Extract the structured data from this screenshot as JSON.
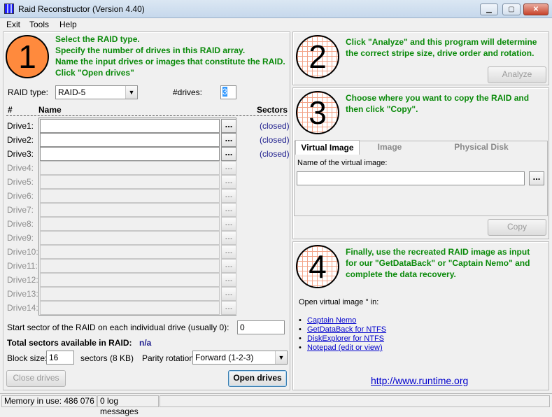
{
  "window": {
    "title": "Raid Reconstructor (Version 4.40)",
    "minimize": "▁",
    "maximize": "▢",
    "close": "✕"
  },
  "menu": [
    "Exit",
    "Tools",
    "Help"
  ],
  "step1": {
    "number": "1",
    "instructions": [
      "Select the RAID type.",
      "Specify the number of drives in this RAID array.",
      "Name the input drives or images that constitute the RAID.",
      "Click \"Open drives\""
    ],
    "raid_type_label": "RAID type:",
    "raid_type_value": "RAID-5",
    "drives_label": "#drives:",
    "drives_value": "3",
    "col_num": "#",
    "col_name": "Name",
    "col_sectors": "Sectors",
    "drives": [
      {
        "label": "Drive1:",
        "status": "(closed)"
      },
      {
        "label": "Drive2:",
        "status": "(closed)"
      },
      {
        "label": "Drive3:",
        "status": "(closed)"
      },
      {
        "label": "Drive4:",
        "status": ""
      },
      {
        "label": "Drive5:",
        "status": ""
      },
      {
        "label": "Drive6:",
        "status": ""
      },
      {
        "label": "Drive7:",
        "status": ""
      },
      {
        "label": "Drive8:",
        "status": ""
      },
      {
        "label": "Drive9:",
        "status": ""
      },
      {
        "label": "Drive10:",
        "status": ""
      },
      {
        "label": "Drive11:",
        "status": ""
      },
      {
        "label": "Drive12:",
        "status": ""
      },
      {
        "label": "Drive13:",
        "status": ""
      },
      {
        "label": "Drive14:",
        "status": ""
      }
    ],
    "browse_label": "...",
    "start_sector_label": "Start sector of the RAID on each individual drive (usually 0):",
    "start_sector_value": "0",
    "total_sectors_label": "Total sectors available in RAID:",
    "total_sectors_value": "n/a",
    "block_size_label": "Block size:",
    "block_size_value": "16",
    "block_size_unit": "sectors (8 KB)",
    "parity_label": "Parity rotation:",
    "parity_value": "Forward (1-2-3)",
    "close_drives": "Close drives",
    "open_drives": "Open drives"
  },
  "step2": {
    "number": "2",
    "instructions": [
      "Click \"Analyze\" and this program will determine",
      "the correct stripe size, drive order and rotation."
    ],
    "analyze": "Analyze"
  },
  "step3": {
    "number": "3",
    "instructions": [
      "Choose where you want to copy the RAID and",
      "then click \"Copy\"."
    ],
    "tabs": [
      "Virtual Image",
      "Image",
      "Physical Disk"
    ],
    "name_label": "Name of the virtual image:",
    "browse_label": "...",
    "copy": "Copy"
  },
  "step4": {
    "number": "4",
    "instructions": [
      "Finally, use the recreated RAID image as input",
      "for our \"GetDataBack\" or \"Captain Nemo\" and",
      "complete the data recovery."
    ],
    "open_label": "Open virtual image '' in:",
    "links": [
      "Captain Nemo",
      "GetDataBack for NTFS",
      "DiskExplorer for NTFS",
      "Notepad (edit or view)"
    ],
    "website": "http://www.runtime.org"
  },
  "status": {
    "memory": "Memory in use: 486 076",
    "log": "0 log messages"
  }
}
